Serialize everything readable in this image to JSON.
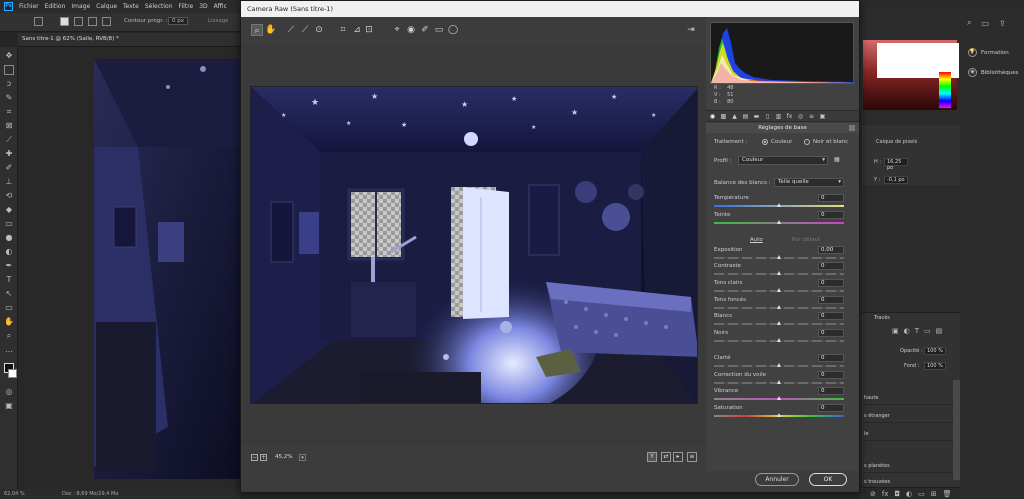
{
  "photoshop": {
    "menu": [
      "Fichier",
      "Edition",
      "Image",
      "Calque",
      "Texte",
      "Sélection",
      "Filtre",
      "3D",
      "Affic"
    ],
    "options": {
      "feather_label": "Contour progr. :",
      "feather_value": "0 px",
      "smooth_label": "Lissage"
    },
    "doc_tab": "Sans titre-1 @ 62% (Salle, RVB/8) *",
    "status": {
      "zoom": "62,04 %",
      "doc": "Doc : 8,69 Mo/29,4 Mo"
    }
  },
  "right_panels": {
    "learn": "Formation",
    "libraries": "Bibliothèques",
    "properties": {
      "pixel_layer": "Calque de pixels",
      "h_label": "H :",
      "h_value": "16,25 po",
      "y_label": "Y :",
      "y_value": "-0,1 po"
    },
    "layers": {
      "tab": "Tracés",
      "opacity_label": "Opacité :",
      "opacity_value": "100 %",
      "fill_label": "Fond :",
      "fill_value": "100 %",
      "rows": [
        "haute",
        "s étranger",
        "le",
        "s planètes",
        "s trouvées"
      ]
    }
  },
  "camera_raw": {
    "title": "Camera Raw (Sans titre-1)",
    "zoom": "45,2%",
    "rgb": {
      "r_label": "R :",
      "r": "48",
      "v_label": "V :",
      "v": "51",
      "b_label": "B :",
      "b": "80"
    },
    "panel_title": "Réglages de base",
    "treatment_label": "Traitement :",
    "treatment_color": "Couleur",
    "treatment_bw": "Noir et blanc",
    "profile_label": "Profil :",
    "profile_value": "Couleur",
    "wb_label": "Balance des blancs :",
    "wb_value": "Telle quelle",
    "auto": "Auto",
    "default": "Par défaut",
    "sliders": [
      {
        "label": "Température",
        "value": "0",
        "pos": 0.5
      },
      {
        "label": "Teinte",
        "value": "0",
        "pos": 0.5
      },
      {
        "label": "Exposition",
        "value": "0,00",
        "pos": 0.5
      },
      {
        "label": "Contraste",
        "value": "0",
        "pos": 0.5
      },
      {
        "label": "Tons clairs",
        "value": "0",
        "pos": 0.5
      },
      {
        "label": "Tons foncés",
        "value": "0",
        "pos": 0.5
      },
      {
        "label": "Blancs",
        "value": "0",
        "pos": 0.5
      },
      {
        "label": "Noirs",
        "value": "0",
        "pos": 0.5
      },
      {
        "label": "Clarté",
        "value": "0",
        "pos": 0.5
      },
      {
        "label": "Correction du voile",
        "value": "0",
        "pos": 0.5
      },
      {
        "label": "Vibrance",
        "value": "0",
        "pos": 0.5
      },
      {
        "label": "Saturation",
        "value": "0",
        "pos": 0.5
      }
    ],
    "cancel": "Annuler",
    "ok": "OK"
  }
}
